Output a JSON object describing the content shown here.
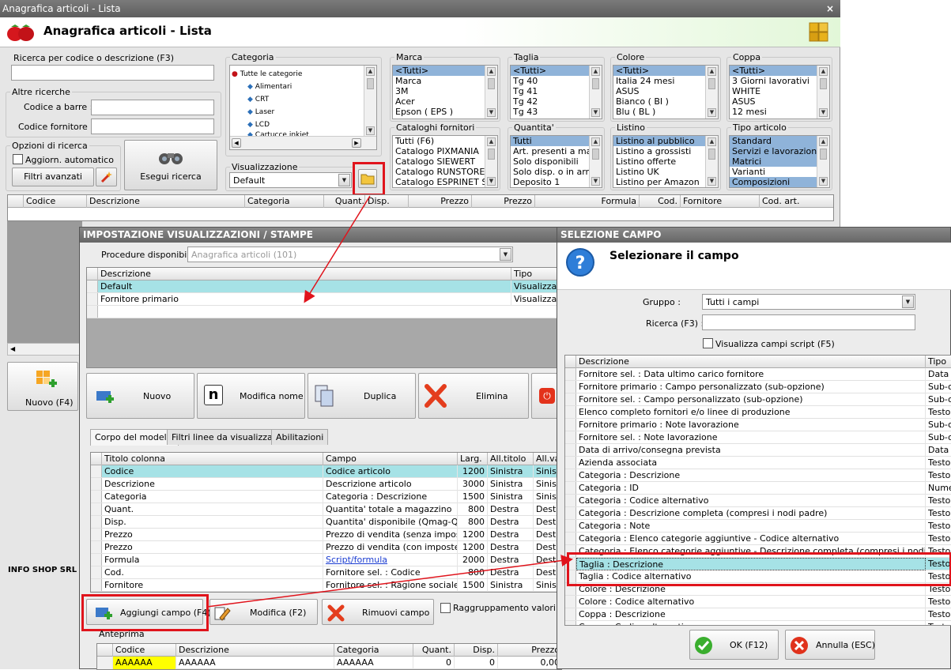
{
  "window": {
    "title": "Anagrafica articoli  - Lista",
    "close": "×",
    "header": "Anagrafica articoli  - Lista"
  },
  "search": {
    "by_code_label": "Ricerca per codice o descrizione (F3)",
    "by_code_value": "",
    "other_label": "Altre ricerche",
    "barcode_label": "Codice a barre :",
    "supplier_code_label": "Codice fornitore :",
    "options_label": "Opzioni di ricerca",
    "auto_update_label": "Aggiorn. automatico",
    "advanced_filters_label": "Filtri avanzati",
    "run_search_label": "Esegui ricerca"
  },
  "category": {
    "label": "Categoria",
    "items": [
      "Tutte le categorie",
      "Alimentari",
      "CRT",
      "Laser",
      "LCD",
      "Cartucce inkjet"
    ]
  },
  "view": {
    "label": "Visualizzazione",
    "value": "Default"
  },
  "filters": [
    {
      "label": "Marca",
      "items": [
        "<Tutti>",
        "Marca",
        "3M",
        "Acer",
        "Epson ( EPS )"
      ],
      "selected": [
        0
      ]
    },
    {
      "label": "Taglia",
      "items": [
        "<Tutti>",
        "Tg 40",
        "Tg 41",
        "Tg 42",
        "Tg 43"
      ],
      "selected": [
        0
      ]
    },
    {
      "label": "Colore",
      "items": [
        "<Tutti>",
        "Italia 24 mesi",
        "ASUS",
        "Bianco ( BI )",
        "Blu ( BL )"
      ],
      "selected": [
        0
      ]
    },
    {
      "label": "Coppa",
      "items": [
        "<Tutti>",
        "3 Giorni lavorativi",
        "WHITE",
        "ASUS",
        "12 mesi"
      ],
      "selected": [
        0
      ]
    },
    {
      "label": "Cataloghi fornitori",
      "items": [
        "Tutti (F6)",
        "Catalogo PIXMANIA",
        "Catalogo SIEWERT",
        "Catalogo RUNSTORE",
        "Catalogo ESPRINET SPA"
      ],
      "selected": []
    },
    {
      "label": "Quantita'",
      "items": [
        "Tutti",
        "Art. presenti a magazzino",
        "Solo disponibili",
        "Solo disp. o in arrivo",
        "Deposito 1"
      ],
      "selected": [
        0
      ]
    },
    {
      "label": "Listino",
      "items": [
        "Listino al pubblico",
        "Listino a grossisti",
        "Listino offerte",
        "Listino UK",
        "Listino per Amazon"
      ],
      "selected": [
        0
      ]
    },
    {
      "label": "Tipo articolo",
      "items": [
        "Standard",
        "Servizi e lavorazioni",
        "Matrici",
        "Varianti",
        "Composizioni"
      ],
      "selected": [
        0,
        1,
        2,
        4
      ]
    }
  ],
  "main_grid": {
    "columns": [
      "Codice",
      "Descrizione",
      "Categoria",
      "Quant.",
      "Disp.",
      "Prezzo",
      "Prezzo",
      "Formula",
      "Cod.",
      "Fornitore",
      "Cod. art."
    ]
  },
  "left_panel": {
    "new_label": "Nuovo (F4)",
    "company": "INFO SHOP SRL"
  },
  "dialog_view": {
    "title": "IMPOSTAZIONE VISUALIZZAZIONI / STAMPE",
    "procedures_label": "Procedure disponibili :",
    "procedures_value": "Anagrafica articoli (101)",
    "list_columns": [
      "Descrizione",
      "Tipo"
    ],
    "list_rows": [
      {
        "descr": "Default",
        "tipo": "Visualizzazio"
      },
      {
        "descr": "Fornitore primario",
        "tipo": "Visualizzazio"
      }
    ],
    "buttons": {
      "new": "Nuovo",
      "rename": "Modifica nome",
      "duplicate": "Duplica",
      "delete": "Elimina"
    },
    "tabs": [
      "Corpo del modello",
      "Filtri linee da visualizzare",
      "Abilitazioni"
    ],
    "model_columns": [
      "Titolo colonna",
      "Campo",
      "Larg.",
      "All.titolo",
      "All.va"
    ],
    "model_rows": [
      {
        "title": "Codice",
        "field": "Codice articolo",
        "width": "1200",
        "align": "Sinistra",
        "valign": "Sinist"
      },
      {
        "title": "Descrizione",
        "field": "Descrizione articolo",
        "width": "3000",
        "align": "Sinistra",
        "valign": "Sinist"
      },
      {
        "title": "Categoria",
        "field": "Categoria : Descrizione",
        "width": "1500",
        "align": "Sinistra",
        "valign": "Sinist"
      },
      {
        "title": "Quant.",
        "field": "Quantita' totale a magazzino",
        "width": "800",
        "align": "Destra",
        "valign": "Destr"
      },
      {
        "title": "Disp.",
        "field": "Quantita' disponibile (Qmag-Qo...",
        "width": "800",
        "align": "Destra",
        "valign": "Destr"
      },
      {
        "title": "Prezzo",
        "field": "Prezzo di vendita (senza imposte)",
        "width": "1200",
        "align": "Destra",
        "valign": "Destr"
      },
      {
        "title": "Prezzo",
        "field": "Prezzo di vendita (con imposte)",
        "width": "1200",
        "align": "Destra",
        "valign": "Destr"
      },
      {
        "title": "Formula",
        "field": "Script/formula",
        "width": "2000",
        "align": "Destra",
        "valign": "Destr"
      },
      {
        "title": "Cod.",
        "field": "Fornitore sel. : Codice",
        "width": "800",
        "align": "Destra",
        "valign": "Destr"
      },
      {
        "title": "Fornitore",
        "field": "Fornitore sel. : Ragione sociale",
        "width": "1500",
        "align": "Sinistra",
        "valign": "Sinist"
      }
    ],
    "add_field": "Aggiungi campo (F4)",
    "edit": "Modifica (F2)",
    "remove": "Rimuovi campo",
    "group_values": "Raggruppamento valori",
    "preview_label": "Anteprima",
    "preview_columns": [
      "Codice",
      "Descrizione",
      "Categoria",
      "Quant.",
      "Disp.",
      "Prezzo"
    ],
    "preview_row": [
      "AAAAAA",
      "AAAAAA",
      "AAAAAA",
      "0",
      "0",
      "0,00"
    ]
  },
  "dialog_field": {
    "title": "SELEZIONE CAMPO",
    "heading": "Selezionare il campo",
    "group_label": "Gruppo :",
    "group_value": "Tutti i campi",
    "search_label": "Ricerca (F3) :",
    "search_value": "",
    "script_label": "Visualizza campi script (F5)",
    "columns": [
      "Descrizione",
      "Tipo"
    ],
    "rows": [
      {
        "d": "Fornitore sel. : Data ultimo carico fornitore",
        "t": "Data"
      },
      {
        "d": "Fornitore primario : Campo personalizzato (sub-opzione)",
        "t": "Sub-op"
      },
      {
        "d": "Fornitore sel. : Campo personalizzato (sub-opzione)",
        "t": "Sub-op"
      },
      {
        "d": "Elenco completo fornitori e/o linee di produzione",
        "t": "Testo"
      },
      {
        "d": "Fornitore primario : Note lavorazione",
        "t": "Sub-op"
      },
      {
        "d": "Fornitore sel. : Note lavorazione",
        "t": "Sub-op"
      },
      {
        "d": "Data di arrivo/consegna prevista",
        "t": "Data"
      },
      {
        "d": "Azienda associata",
        "t": "Testo"
      },
      {
        "d": "Categoria : Descrizione",
        "t": "Testo"
      },
      {
        "d": "Categoria : ID",
        "t": "Numer"
      },
      {
        "d": "Categoria : Codice alternativo",
        "t": "Testo"
      },
      {
        "d": "Categoria : Descrizione completa (compresi i nodi padre)",
        "t": "Testo"
      },
      {
        "d": "Categoria : Note",
        "t": "Testo"
      },
      {
        "d": "Categoria : Elenco categorie aggiuntive - Codice alternativo",
        "t": "Testo"
      },
      {
        "d": "Categoria : Elenco categorie aggiuntive - Descrizione completa (compresi i nodi padre)",
        "t": "Testo"
      },
      {
        "d": "Taglia : Descrizione",
        "t": "Testo"
      },
      {
        "d": "Taglia : Codice alternativo",
        "t": "Testo"
      },
      {
        "d": "Colore : Descrizione",
        "t": "Testo"
      },
      {
        "d": "Colore : Codice alternativo",
        "t": "Testo"
      },
      {
        "d": "Coppa : Descrizione",
        "t": "Testo"
      },
      {
        "d": "Coppa : Codice alternativo",
        "t": "Testo"
      }
    ],
    "ok": "OK (F12)",
    "cancel": "Annulla (ESC)"
  },
  "colors": {
    "highlight": "#a6e2e6",
    "selection": "#8fb3d9",
    "annotation": "#e0141c",
    "preview_code_bg": "#ffff00"
  }
}
